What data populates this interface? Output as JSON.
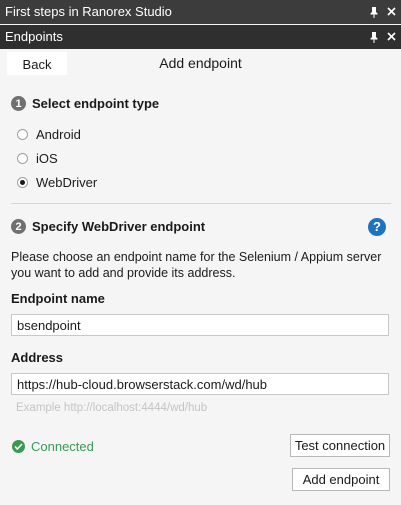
{
  "window": {
    "title": "First steps in Ranorex Studio",
    "subtitle": "Endpoints"
  },
  "header": {
    "back_label": "Back",
    "title": "Add endpoint"
  },
  "step1": {
    "number": "1",
    "title": "Select endpoint type",
    "options": [
      {
        "label": "Android",
        "selected": false
      },
      {
        "label": "iOS",
        "selected": false
      },
      {
        "label": "WebDriver",
        "selected": true
      }
    ]
  },
  "step2": {
    "number": "2",
    "title": "Specify WebDriver endpoint",
    "help_glyph": "?",
    "description": "Please choose an endpoint name for the Selenium / Appium server you want to add and provide its address."
  },
  "fields": {
    "name_label": "Endpoint name",
    "name_value": "bsendpoint",
    "address_label": "Address",
    "address_value": "https://hub-cloud.browserstack.com/wd/hub",
    "example_text": "Example http://localhost:4444/wd/hub"
  },
  "status": {
    "text": "Connected",
    "color": "#3a9a52"
  },
  "buttons": {
    "test_connection": "Test connection",
    "add_endpoint": "Add endpoint"
  },
  "colors": {
    "titlebar": "#3c3c3c",
    "help": "#1e73be"
  }
}
